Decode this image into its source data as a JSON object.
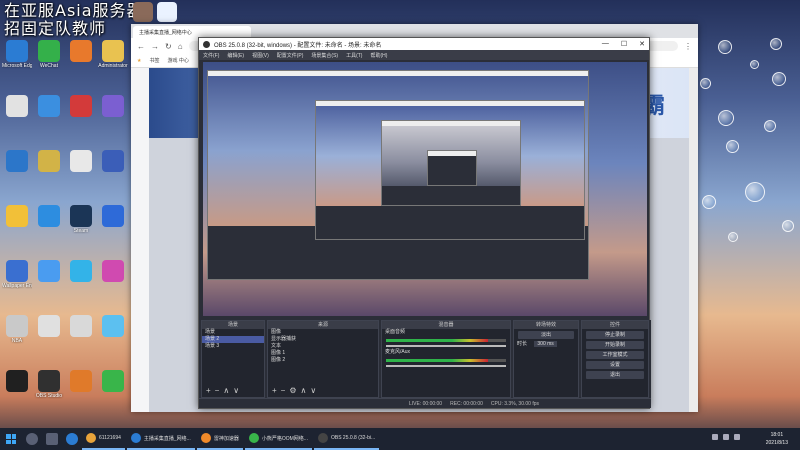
{
  "overlay": {
    "line1": "在亚服Asia服务器",
    "line2": "招固定队教师"
  },
  "desktop_icons": [
    {
      "label": "Microsoft Edge",
      "color": "#2b7cd3"
    },
    {
      "label": "WeChat",
      "color": "#34b04a"
    },
    {
      "label": "",
      "color": "#e8792c"
    },
    {
      "label": "Administrator",
      "color": "#e9c250"
    },
    {
      "label": "",
      "color": "#e2e2e2"
    },
    {
      "label": "",
      "color": "#3b8fe0"
    },
    {
      "label": "",
      "color": "#d33a3a"
    },
    {
      "label": "",
      "color": "#7b5fd1"
    },
    {
      "label": "",
      "color": "#2c76c9"
    },
    {
      "label": "",
      "color": "#d2b347"
    },
    {
      "label": "",
      "color": "#e8e8e8"
    },
    {
      "label": "",
      "color": "#3b5eb8"
    },
    {
      "label": "",
      "color": "#f2c038"
    },
    {
      "label": "",
      "color": "#2d8de0"
    },
    {
      "label": "Steam",
      "color": "#1b3556"
    },
    {
      "label": "",
      "color": "#2e6ad8"
    },
    {
      "label": "Wallpaper Engine",
      "color": "#3a6fd0"
    },
    {
      "label": "",
      "color": "#4a9cf0"
    },
    {
      "label": "",
      "color": "#33b3e8"
    },
    {
      "label": "",
      "color": "#d04ab0"
    },
    {
      "label": "NBA",
      "color": "#c9c9c9"
    },
    {
      "label": "",
      "color": "#e0e0e0"
    },
    {
      "label": "",
      "color": "#d9d9d9"
    },
    {
      "label": "",
      "color": "#5cc0f0"
    },
    {
      "label": "",
      "color": "#202020"
    },
    {
      "label": "OBS Studio",
      "color": "#303030"
    },
    {
      "label": "",
      "color": "#e07a2a"
    },
    {
      "label": "",
      "color": "#39b54a"
    }
  ],
  "browser": {
    "tab_title": "主播采集直播_网络中心",
    "address": "",
    "bookmarks": [
      "书签",
      "游戏 中心",
      "",
      ""
    ]
  },
  "banner": {
    "brand": "霸"
  },
  "obs": {
    "title": "OBS 25.0.8 (32-bit, windows) - 配置文件: 未命名 - 场景: 未命名",
    "menu": [
      "文件(F)",
      "编辑(E)",
      "视图(V)",
      "配置文件(P)",
      "场景集合(S)",
      "工具(T)",
      "帮助(H)"
    ],
    "panels": {
      "scenes": {
        "header": "场景",
        "items": [
          "场景",
          "场景 2",
          "场景 3"
        ]
      },
      "sources": {
        "header": "来源",
        "items": [
          "图像",
          "显示器捕获",
          "文本",
          "图像 1",
          "图像 2"
        ]
      },
      "mixer": {
        "header": "混音器",
        "channels": [
          "桌面音频",
          "麦克风/Aux"
        ]
      },
      "transitions": {
        "header": "转场特效",
        "type": "淡出",
        "duration_label": "时长",
        "duration": "300 ms"
      },
      "controls": {
        "header": "控件",
        "buttons": [
          "停止录制",
          "开始录制",
          "工作室模式",
          "设置",
          "退出"
        ]
      }
    },
    "status": {
      "live": "LIVE: 00:00:00",
      "rec": "REC: 00:00:00",
      "cpu": "CPU: 3.3%, 30.00 fps"
    }
  },
  "taskbar": {
    "tasks": [
      {
        "label": "61121694",
        "color": "#e8a33a"
      },
      {
        "label": "主播采集直播_网络...",
        "color": "#2b7cd3"
      },
      {
        "label": "雷神加速器",
        "color": "#f08a2a"
      },
      {
        "label": "小熊严格OOM网络...",
        "color": "#39b54a"
      },
      {
        "label": "OBS 25.0.8 (32-bi...",
        "color": "#444444"
      }
    ],
    "time": "18:01",
    "date": "2021/8/13"
  }
}
